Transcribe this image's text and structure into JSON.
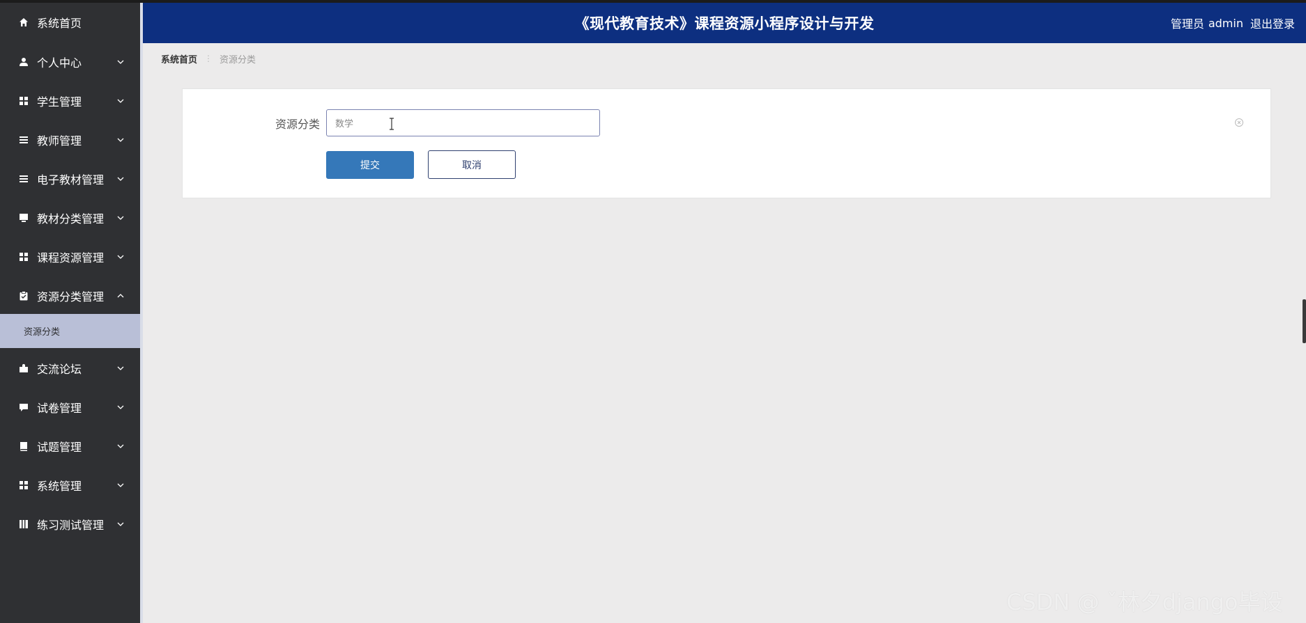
{
  "header": {
    "title": "《现代教育技术》课程资源小程序设计与开发",
    "user_role": "管理员",
    "username": "admin",
    "logout": "退出登录"
  },
  "sidebar": {
    "items": [
      {
        "label": "系统首页",
        "icon": "home-icon"
      },
      {
        "label": "个人中心",
        "icon": "user-icon"
      },
      {
        "label": "学生管理",
        "icon": "grid-icon"
      },
      {
        "label": "教师管理",
        "icon": "list-icon"
      },
      {
        "label": "电子教材管理",
        "icon": "list-icon"
      },
      {
        "label": "教材分类管理",
        "icon": "monitor-icon"
      },
      {
        "label": "课程资源管理",
        "icon": "grid-icon"
      },
      {
        "label": "资源分类管理",
        "icon": "clipboard-check-icon"
      },
      {
        "label": "交流论坛",
        "icon": "puzzle-icon"
      },
      {
        "label": "试卷管理",
        "icon": "chat-icon"
      },
      {
        "label": "试题管理",
        "icon": "book-icon"
      },
      {
        "label": "系统管理",
        "icon": "grid-icon"
      },
      {
        "label": "练习测试管理",
        "icon": "notebook-icon"
      }
    ],
    "active_subitem": "资源分类"
  },
  "breadcrumb": {
    "home": "系统首页",
    "separator": "⋮",
    "current": "资源分类"
  },
  "form": {
    "label": "资源分类",
    "value": "数学",
    "submit": "提交",
    "cancel": "取消"
  },
  "watermark": "CSDN @ ˇ林夕django毕设",
  "colors": {
    "header_bg": "#0d2f80",
    "sidebar_bg": "#2f3033",
    "active_sub_bg": "#b9bfd7",
    "primary_button": "#3578b9",
    "page_bg": "#ecebeb"
  }
}
